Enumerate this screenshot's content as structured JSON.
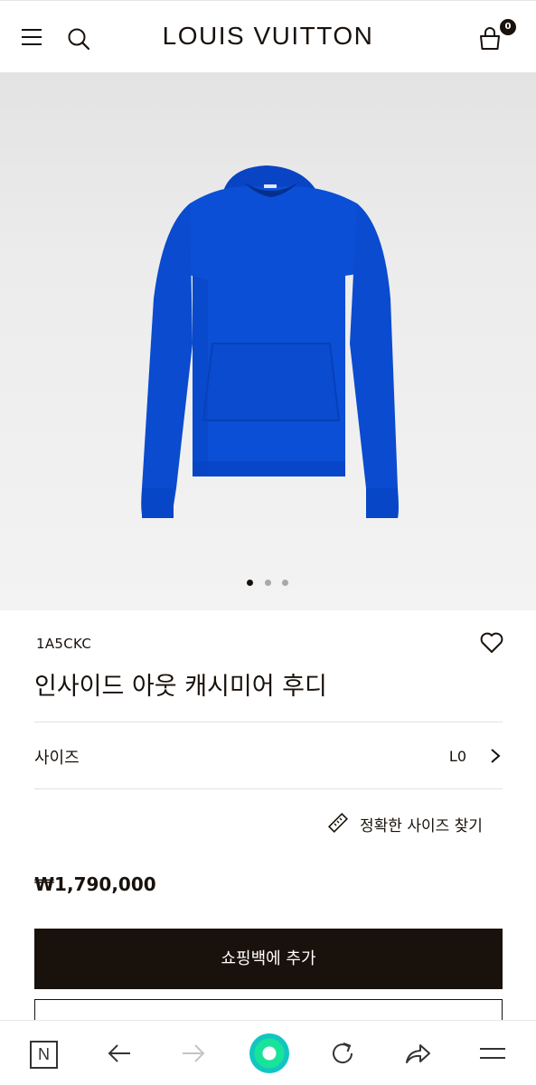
{
  "header": {
    "brand": "LOUIS VUITTON",
    "bag_count": "0"
  },
  "gallery": {
    "image_subject": "blue cashmere hoodie",
    "slide_count": 3,
    "active_slide": 1,
    "colors": {
      "product": "#0a4fd6",
      "product_shadow": "#0740b8"
    }
  },
  "product": {
    "sku": "1A5CKC",
    "title": "인사이드 아웃 캐시미어 후디",
    "size_label": "사이즈",
    "size_value": "L0",
    "size_guide": "정확한 사이즈 찾기",
    "price": "₩1,790,000"
  },
  "actions": {
    "add_to_bag": "쇼핑백에 추가"
  },
  "browser": {
    "home_label": "N"
  },
  "theme": {
    "text": "#19110b",
    "button_bg": "#19110b",
    "accent_green": "#19e29a"
  }
}
